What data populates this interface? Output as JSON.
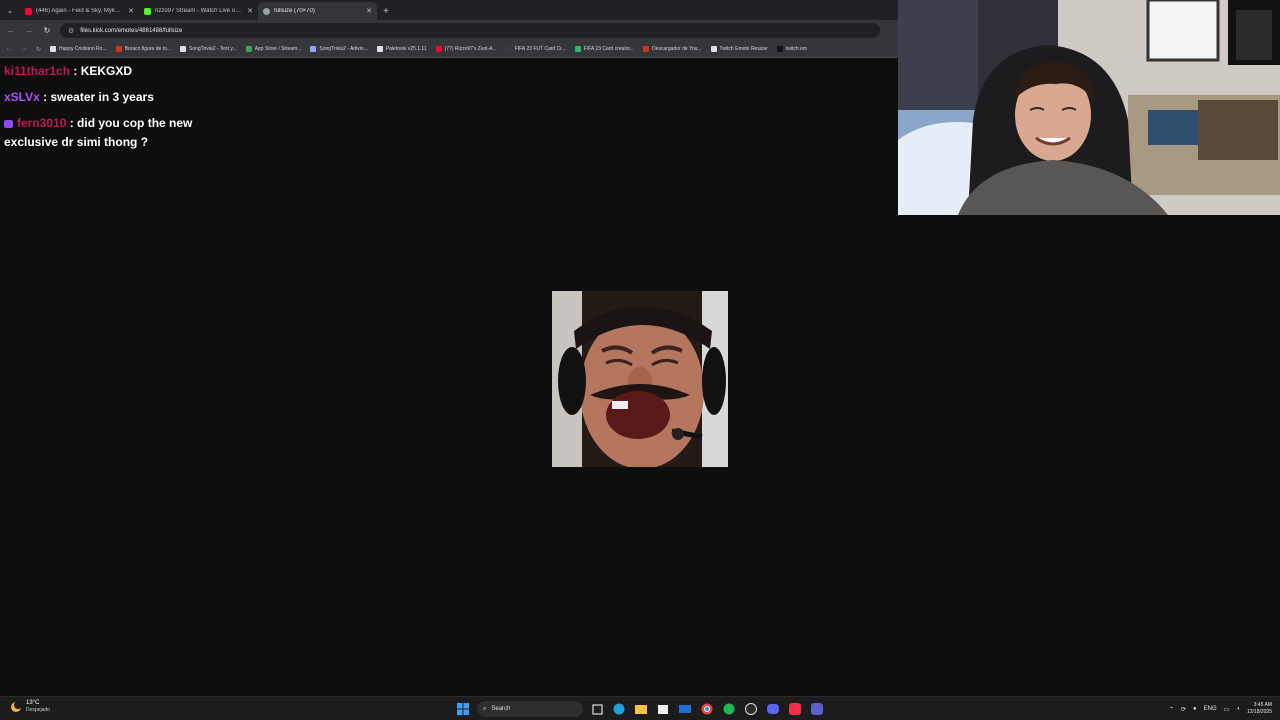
{
  "browser": {
    "menu_label": "⌄",
    "tabs": [
      {
        "title": "(446) Again - Feid & Sky, Myk...",
        "favicon_color": "#ff0033",
        "active": false
      },
      {
        "title": "rizzo97 Stream - Watch Live on...",
        "favicon_color": "#53fc18",
        "active": false
      },
      {
        "title": "fullsize (70×70)",
        "favicon_color": "#9aa0a6",
        "active": true
      }
    ],
    "new_tab_label": "+",
    "url": "files.kick.com/emotes/4861488/fullsize",
    "bookmarks": [
      {
        "label": "Happy Cristiano Ro...",
        "color": "#e0e0e0"
      },
      {
        "label": "Buraco figura de to...",
        "color": "#d93025"
      },
      {
        "label": "SongTrivia2 - Test y...",
        "color": "#e0e0e0"
      },
      {
        "label": "App Store / Stream...",
        "color": "#34a853"
      },
      {
        "label": "SongTrivia2 - Adivin...",
        "color": "#9aa0ff"
      },
      {
        "label": "Paletools v25.1.11",
        "color": "#e0e0e0"
      },
      {
        "label": "(77) Rizzo97's Zest-A...",
        "color": "#ff0033"
      },
      {
        "label": "FIFA 23 FUT Card Cr...",
        "color": "#3a3a3a"
      },
      {
        "label": "FIFA 23 Card creator...",
        "color": "#2bb673"
      },
      {
        "label": "Descargador de You...",
        "color": "#d93025"
      },
      {
        "label": "Twitch Emote Resizer",
        "color": "#e0e0e0"
      },
      {
        "label": "twitch em",
        "color": "#111111"
      }
    ]
  },
  "chat": {
    "messages": [
      {
        "user": "ki11thar1ch",
        "user_color": "#c2185b",
        "text": "KEKGXD",
        "badge": false
      },
      {
        "user": "xSLVx",
        "user_color": "#a855f7",
        "text": "sweater in 3 years",
        "badge": false
      },
      {
        "user": "fern3010",
        "user_color": "#c2185b",
        "text": "did you cop the new exclusive dr simi thong ?",
        "badge": true
      }
    ],
    "separator": " : "
  },
  "taskbar": {
    "weather_temp": "13°C",
    "weather_cond": "Despejado",
    "search_label": "Search",
    "lang": "ENG",
    "time": "3:45 AM",
    "date": "12/18/2025"
  }
}
